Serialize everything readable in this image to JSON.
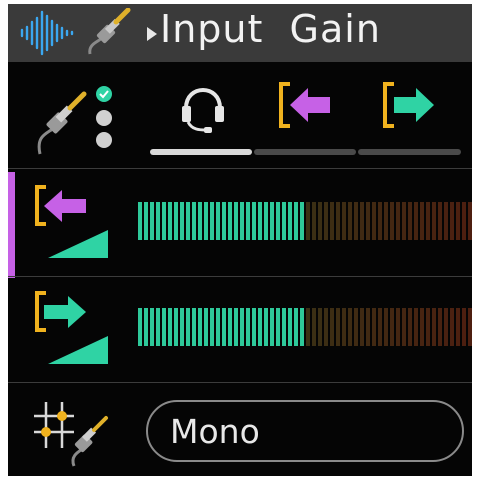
{
  "header": {
    "title": "Input  Gain",
    "icons": [
      "waveform-icon",
      "instrument-cable-icon",
      "breadcrumb-arrow-icon"
    ]
  },
  "routing": {
    "icons": [
      "cable-routing-status-icon",
      "headphones-icon",
      "input-arrow-icon",
      "output-arrow-icon"
    ],
    "selected_index": 0
  },
  "input_row": {
    "icon": "input-gain-icon",
    "level_fraction": 0.5
  },
  "output_row": {
    "icon": "output-gain-icon",
    "level_fraction": 0.5
  },
  "mode_row": {
    "icon": "settings-cable-icon",
    "value": "Mono"
  },
  "colors": {
    "background": "#050505",
    "header": "#3a3a3a",
    "accent_pink": "#c661e6",
    "accent_green": "#2fd3a4",
    "bracket_yellow": "#f0b21e",
    "meter_active": "#2ec99a",
    "meter_inactive": "#3a2818"
  }
}
